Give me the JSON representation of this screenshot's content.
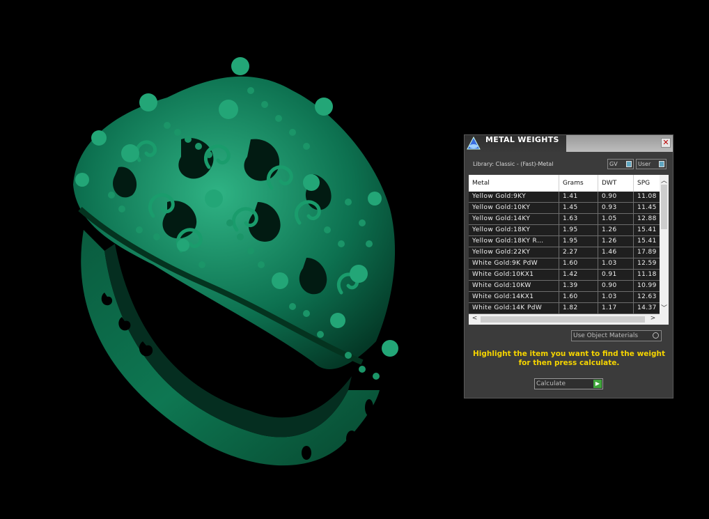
{
  "panel": {
    "title": "METAL WEIGHTS",
    "close_glyph": "✕",
    "library_label": "Library: Classic - (Fast)-Metal",
    "toggles": {
      "gv": "GV",
      "user": "User"
    },
    "table": {
      "columns": [
        "Metal",
        "Grams",
        "DWT",
        "SPG"
      ],
      "rows": [
        [
          "Yellow Gold:9KY",
          "1.41",
          "0.90",
          "11.08"
        ],
        [
          "Yellow Gold:10KY",
          "1.45",
          "0.93",
          "11.45"
        ],
        [
          "Yellow Gold:14KY",
          "1.63",
          "1.05",
          "12.88"
        ],
        [
          "Yellow Gold:18KY",
          "1.95",
          "1.26",
          "15.41"
        ],
        [
          "Yellow Gold:18KY R…",
          "1.95",
          "1.26",
          "15.41"
        ],
        [
          "Yellow Gold:22KY",
          "2.27",
          "1.46",
          "17.89"
        ],
        [
          "White Gold:9K PdW",
          "1.60",
          "1.03",
          "12.59"
        ],
        [
          "White Gold:10KX1",
          "1.42",
          "0.91",
          "11.18"
        ],
        [
          "White Gold:10KW",
          "1.39",
          "0.90",
          "10.99"
        ],
        [
          "White Gold:14KX1",
          "1.60",
          "1.03",
          "12.63"
        ],
        [
          "White Gold:14K PdW",
          "1.82",
          "1.17",
          "14.37"
        ]
      ]
    },
    "use_object_materials": "Use Object Materials",
    "hint": "Highlight the item you want to find the weight for then press calculate.",
    "calculate_label": "Calculate"
  },
  "icons": {
    "app": "jewelry-app-icon",
    "close": "close-icon",
    "scroll_up": "chevron-up-icon",
    "scroll_down": "chevron-down-icon",
    "scroll_left": "chevron-left-icon",
    "scroll_right": "chevron-right-icon",
    "calculate": "play-icon"
  },
  "colors": {
    "model": "#0c6b4a",
    "hint": "#f5d400",
    "accent": "#5fa6c0",
    "go": "#3fa63b"
  }
}
